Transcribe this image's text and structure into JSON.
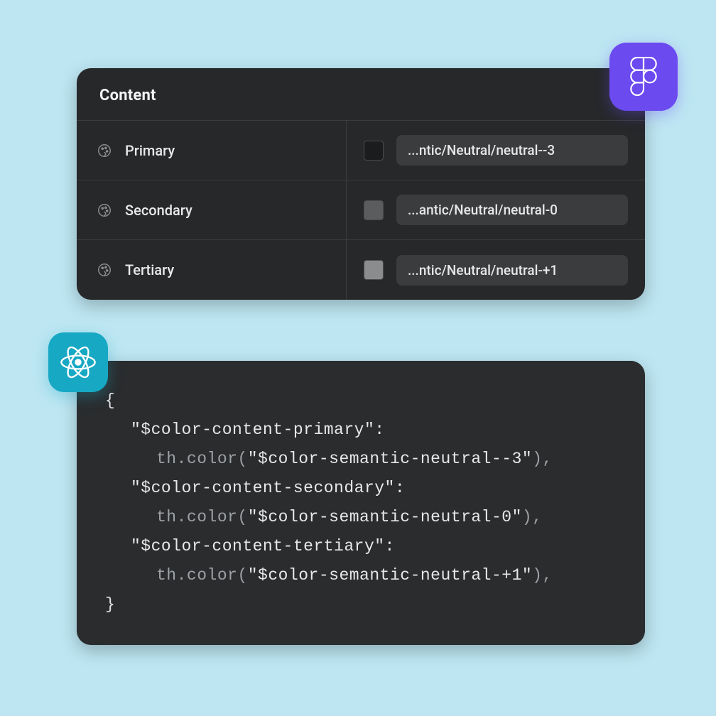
{
  "figma_panel": {
    "title": "Content",
    "rows": [
      {
        "name": "Primary",
        "swatch": "#1b1c1d",
        "token": "...ntic/Neutral/neutral--3"
      },
      {
        "name": "Secondary",
        "swatch": "#5a5c5e",
        "token": "...antic/Neutral/neutral-0"
      },
      {
        "name": "Tertiary",
        "swatch": "#8a8c8e",
        "token": "...ntic/Neutral/neutral-+1"
      }
    ]
  },
  "code_panel": {
    "brace_open": "{",
    "brace_close": "}",
    "entries": [
      {
        "key": "\"$color-content-primary\":",
        "value_prefix": "th.color(",
        "value_string": "\"$color-semantic-neutral--3\"",
        "value_suffix": "),"
      },
      {
        "key": "\"$color-content-secondary\":",
        "value_prefix": "th.color(",
        "value_string": "\"$color-semantic-neutral-0\"",
        "value_suffix": "),"
      },
      {
        "key": "\"$color-content-tertiary\":",
        "value_prefix": "th.color(",
        "value_string": "\"$color-semantic-neutral-+1\"",
        "value_suffix": "),"
      }
    ]
  },
  "badges": {
    "figma": "figma",
    "react": "react"
  },
  "colors": {
    "bg": "#bde6f2",
    "panel_dark": "#26282a",
    "code_dark": "#2a2c2e",
    "figma_purple": "#6b4af0",
    "react_teal": "#17a8c4"
  }
}
